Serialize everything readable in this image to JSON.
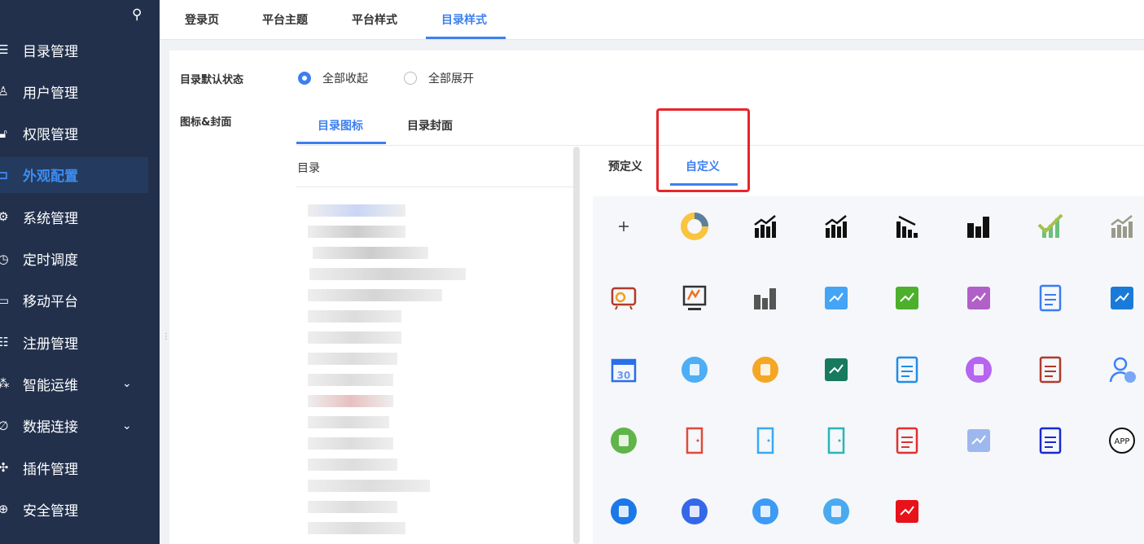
{
  "sidebar": {
    "items": [
      {
        "label": "目录管理",
        "icon": "list-icon"
      },
      {
        "label": "用户管理",
        "icon": "user-icon"
      },
      {
        "label": "权限管理",
        "icon": "lock-icon"
      },
      {
        "label": "外观配置",
        "icon": "paint-roller-icon",
        "active": true
      },
      {
        "label": "系统管理",
        "icon": "gear-icon"
      },
      {
        "label": "定时调度",
        "icon": "timer-icon"
      },
      {
        "label": "移动平台",
        "icon": "tablet-icon"
      },
      {
        "label": "注册管理",
        "icon": "register-icon"
      },
      {
        "label": "智能运维",
        "icon": "network-icon",
        "expandable": true
      },
      {
        "label": "数据连接",
        "icon": "link-icon",
        "expandable": true
      },
      {
        "label": "插件管理",
        "icon": "plugin-icon"
      },
      {
        "label": "安全管理",
        "icon": "shield-icon"
      }
    ]
  },
  "top_tabs": [
    "登录页",
    "平台主题",
    "平台样式",
    "目录样式"
  ],
  "top_active": 3,
  "form": {
    "default_state_label": "目录默认状态",
    "options": [
      "全部收起",
      "全部展开"
    ],
    "selected": 0,
    "icon_cover_label": "图标&封面",
    "sub_tabs": [
      "目录图标",
      "目录封面"
    ],
    "tree_header": "目录",
    "icon_tabs": [
      "预定义",
      "自定义"
    ]
  },
  "icons": [
    {
      "name": "add-icon",
      "color": "#333",
      "shape": "plus"
    },
    {
      "name": "donut-chart-icon",
      "color": "#f9c440",
      "shape": "donut"
    },
    {
      "name": "line-bar-chart-icon",
      "color": "#111",
      "shape": "barsup"
    },
    {
      "name": "trend-up-icon",
      "color": "#111",
      "shape": "barsup"
    },
    {
      "name": "trend-down-icon",
      "color": "#111",
      "shape": "barsdown"
    },
    {
      "name": "bar-chart-icon",
      "color": "#111",
      "shape": "bars"
    },
    {
      "name": "check-chart-icon",
      "color": "#6cc07a",
      "shape": "check"
    },
    {
      "name": "growth-chart-icon",
      "color": "#9a9a88",
      "shape": "barsup"
    },
    {
      "name": "presentation-icon",
      "color": "#b33a2a",
      "shape": "board"
    },
    {
      "name": "monitor-chart-icon",
      "color": "#333",
      "shape": "monitor"
    },
    {
      "name": "column-chart-icon",
      "color": "#555",
      "shape": "bars"
    },
    {
      "name": "tool-board-icon",
      "color": "#44a4f5",
      "shape": "rect"
    },
    {
      "name": "green-report-icon",
      "color": "#4cb02c",
      "shape": "rect"
    },
    {
      "name": "purple-chart-icon",
      "color": "#b160c8",
      "shape": "rect"
    },
    {
      "name": "document-icon",
      "color": "#3b7cf0",
      "shape": "doc"
    },
    {
      "name": "blue-chart-icon",
      "color": "#1a7ad8",
      "shape": "rect"
    },
    {
      "name": "calendar-icon",
      "color": "#2a6ee8",
      "shape": "cal"
    },
    {
      "name": "pie-circle-icon",
      "color": "#4daef5",
      "shape": "circle"
    },
    {
      "name": "clipboard-chart-icon",
      "color": "#f5a623",
      "shape": "circle"
    },
    {
      "name": "contact-card-icon",
      "color": "#177a5e",
      "shape": "rect"
    },
    {
      "name": "user-list-icon",
      "color": "#1e8de8",
      "shape": "doc"
    },
    {
      "name": "user-avatar-icon",
      "color": "#b565f0",
      "shape": "circle"
    },
    {
      "name": "user-frame-icon",
      "color": "#b03a2a",
      "shape": "doc"
    },
    {
      "name": "user-stats-icon",
      "color": "#3b82f6",
      "shape": "person"
    },
    {
      "name": "android-icon",
      "color": "#5fb548",
      "shape": "circle"
    },
    {
      "name": "red-door-icon",
      "color": "#e04a3a",
      "shape": "door"
    },
    {
      "name": "open-door-icon",
      "color": "#3aa8f0",
      "shape": "door"
    },
    {
      "name": "teal-door-icon",
      "color": "#2bb5b5",
      "shape": "door"
    },
    {
      "name": "search-store-icon",
      "color": "#e03030",
      "shape": "doc"
    },
    {
      "name": "id-card-icon",
      "color": "#9db8ee",
      "shape": "rect"
    },
    {
      "name": "lock-door-icon",
      "color": "#1a2ad0",
      "shape": "doc"
    },
    {
      "name": "app-icon",
      "color": "#111",
      "shape": "app"
    },
    {
      "name": "light-door-icon",
      "color": "#1a78e8",
      "shape": "circle"
    },
    {
      "name": "store-icon",
      "color": "#3568e8",
      "shape": "circle"
    },
    {
      "name": "screen-check-icon",
      "color": "#3d9af5",
      "shape": "circle"
    },
    {
      "name": "door-circle-icon",
      "color": "#4aaaf0",
      "shape": "circle"
    },
    {
      "name": "cube-icon",
      "color": "#e8121a",
      "shape": "rect"
    }
  ]
}
